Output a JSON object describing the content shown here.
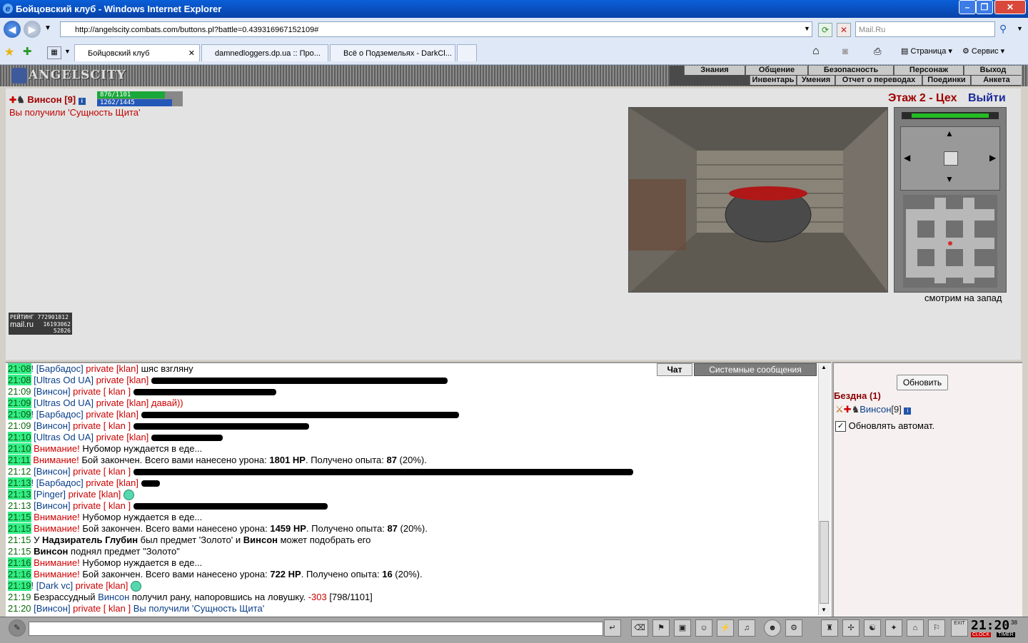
{
  "window": {
    "title": "Бойцовский клуб - Windows Internet Explorer"
  },
  "browser": {
    "address": "http://angelscity.combats.com/buttons.pl?battle=0.439316967152109#",
    "search_placeholder": "Mail.Ru",
    "tabs": [
      {
        "label": "Бойцовский клуб",
        "active": true
      },
      {
        "label": "damnedloggers.dp.ua :: Про...",
        "active": false
      },
      {
        "label": "Всё о Подземельях - DarkCl...",
        "active": false
      }
    ],
    "toolbar": {
      "page": "Страница",
      "tools": "Сервис"
    }
  },
  "game": {
    "logo": "ANGELSCITY",
    "menu_top": [
      "Знания",
      "Общение",
      "Безопасность",
      "Персонаж",
      "Выход"
    ],
    "menu_bottom": [
      "Инвентарь",
      "Умения",
      "Отчет о переводах",
      "Поединки",
      "Анкета"
    ],
    "player": {
      "name": "Винсон",
      "level": "[9]",
      "hp": "876/1101",
      "hp_fraction": 0.795,
      "mana": "1262/1445",
      "mana_fraction": 0.873
    },
    "notice": "Вы получили 'Сущность Щита'",
    "location": "Этаж 2 - Цех",
    "exit": "Выйти",
    "facing": "смотрим на запад",
    "rating": {
      "line1": "РЕЙТИНГ 772901812",
      "logo": "mail.ru",
      "n1": "16193062",
      "n2": "52826"
    }
  },
  "chat": {
    "tabs": [
      "Чат",
      "Системные сообщения"
    ],
    "lines": [
      {
        "time": "21:08",
        "hl": true,
        "parts": [
          {
            "c": "n",
            "t": "! [Барбадос] "
          },
          {
            "c": "p",
            "t": "private [klan] "
          },
          {
            "c": "",
            "t": "шяс взгляну"
          }
        ]
      },
      {
        "time": "21:08",
        "hl": true,
        "parts": [
          {
            "c": "n",
            "t": " [Ultras Od UA] "
          },
          {
            "c": "p",
            "t": "private [klan] "
          }
        ],
        "redact": 415
      },
      {
        "time": "21:09",
        "hl": false,
        "parts": [
          {
            "c": "n",
            "t": " [Винсон] "
          },
          {
            "c": "p",
            "t": "private [ klan ] "
          }
        ],
        "redact": 200
      },
      {
        "time": "21:09",
        "hl": true,
        "parts": [
          {
            "c": "n",
            "t": " [Ultras Od UA] "
          },
          {
            "c": "p",
            "t": "private [klan] "
          },
          {
            "c": "p",
            "t": "давай))"
          }
        ]
      },
      {
        "time": "21:09",
        "hl": true,
        "parts": [
          {
            "c": "n",
            "t": "! [Барбадос] "
          },
          {
            "c": "p",
            "t": "private [klan] "
          }
        ],
        "redact": 445
      },
      {
        "time": "21:09",
        "hl": false,
        "parts": [
          {
            "c": "n",
            "t": " [Винсон] "
          },
          {
            "c": "p",
            "t": "private [ klan ] "
          }
        ],
        "redact": 246
      },
      {
        "time": "21:10",
        "hl": true,
        "parts": [
          {
            "c": "n",
            "t": " [Ultras Od UA] "
          },
          {
            "c": "p",
            "t": "private [klan] "
          }
        ],
        "redact": 100
      },
      {
        "time": "21:10",
        "hl": true,
        "parts": [
          {
            "c": "w",
            "t": " Внимание! "
          },
          {
            "c": "",
            "t": "Нубомор нуждается в еде..."
          }
        ]
      },
      {
        "time": "21:11",
        "hl": true,
        "parts": [
          {
            "c": "w",
            "t": " Внимание! "
          },
          {
            "c": "",
            "t": "Бой закончен. Всего вами нанесено урона: "
          },
          {
            "c": "b",
            "t": "1801 HP"
          },
          {
            "c": "",
            "t": ". Получено опыта: "
          },
          {
            "c": "b",
            "t": "87"
          },
          {
            "c": "",
            "t": " (20%)."
          }
        ]
      },
      {
        "time": "21:12",
        "hl": false,
        "parts": [
          {
            "c": "n",
            "t": " [Винсон] "
          },
          {
            "c": "p",
            "t": "private [ klan ] "
          }
        ],
        "redact": 710
      },
      {
        "time": "21:13",
        "hl": true,
        "parts": [
          {
            "c": "n",
            "t": "! [Барбадос] "
          },
          {
            "c": "p",
            "t": "private [klan] "
          }
        ],
        "redact": 26
      },
      {
        "time": "21:13",
        "hl": true,
        "parts": [
          {
            "c": "n",
            "t": " [Pinger] "
          },
          {
            "c": "p",
            "t": "private [klan] "
          }
        ],
        "smile": true
      },
      {
        "time": "21:13",
        "hl": false,
        "parts": [
          {
            "c": "n",
            "t": " [Винсон] "
          },
          {
            "c": "p",
            "t": "private [ klan ] "
          }
        ],
        "redact": 272
      },
      {
        "time": "21:15",
        "hl": true,
        "parts": [
          {
            "c": "w",
            "t": " Внимание! "
          },
          {
            "c": "",
            "t": "Нубомор нуждается в еде..."
          }
        ]
      },
      {
        "time": "21:15",
        "hl": true,
        "parts": [
          {
            "c": "w",
            "t": " Внимание! "
          },
          {
            "c": "",
            "t": "Бой закончен. Всего вами нанесено урона: "
          },
          {
            "c": "b",
            "t": "1459 HP"
          },
          {
            "c": "",
            "t": ". Получено опыта: "
          },
          {
            "c": "b",
            "t": "87"
          },
          {
            "c": "",
            "t": " (20%)."
          }
        ]
      },
      {
        "time": "21:15",
        "hl": false,
        "parts": [
          {
            "c": "",
            "t": " У "
          },
          {
            "c": "b",
            "t": "Надзиратель Глубин"
          },
          {
            "c": "",
            "t": " был предмет 'Золото' и "
          },
          {
            "c": "b",
            "t": "Винсон"
          },
          {
            "c": "",
            "t": " может подобрать его"
          }
        ]
      },
      {
        "time": "21:15",
        "hl": false,
        "parts": [
          {
            "c": "b",
            "t": " Винсон"
          },
          {
            "c": "",
            "t": " поднял предмет \"Золото\""
          }
        ]
      },
      {
        "time": "21:16",
        "hl": true,
        "parts": [
          {
            "c": "w",
            "t": " Внимание! "
          },
          {
            "c": "",
            "t": "Нубомор нуждается в еде..."
          }
        ]
      },
      {
        "time": "21:16",
        "hl": true,
        "parts": [
          {
            "c": "w",
            "t": " Внимание! "
          },
          {
            "c": "",
            "t": "Бой закончен. Всего вами нанесено урона: "
          },
          {
            "c": "b",
            "t": "722 HP"
          },
          {
            "c": "",
            "t": ". Получено опыта: "
          },
          {
            "c": "b",
            "t": "16"
          },
          {
            "c": "",
            "t": " (20%)."
          }
        ]
      },
      {
        "time": "21:19",
        "hl": true,
        "parts": [
          {
            "c": "n",
            "t": "! [Dark vc] "
          },
          {
            "c": "p",
            "t": "private [klan] "
          }
        ],
        "smile": true
      },
      {
        "time": "21:19",
        "hl": false,
        "parts": [
          {
            "c": "",
            "t": " Безрассудный "
          },
          {
            "c": "n",
            "t": "Винсон"
          },
          {
            "c": "",
            "t": " получил рану, напоровшись на ловушку. "
          },
          {
            "c": "w",
            "t": "-303"
          },
          {
            "c": "",
            "t": " [798/1101]"
          }
        ]
      },
      {
        "time": "21:20",
        "hl": false,
        "parts": [
          {
            "c": "n",
            "t": " [Винсон] "
          },
          {
            "c": "p",
            "t": "private [ klan ] "
          },
          {
            "c": "n",
            "t": "Вы получили 'Сущность Щита'"
          }
        ]
      }
    ]
  },
  "side": {
    "refresh": "Обновить",
    "room": "Бездна (1)",
    "player": "Винсон",
    "level": "[9]",
    "auto": "Обновлять автомат."
  },
  "bottom": {
    "clock_time": "21:20",
    "clock_sec": "38",
    "clock_label": "CLOCK",
    "timer_label": "TIMER",
    "exit_label": "EXIT"
  }
}
